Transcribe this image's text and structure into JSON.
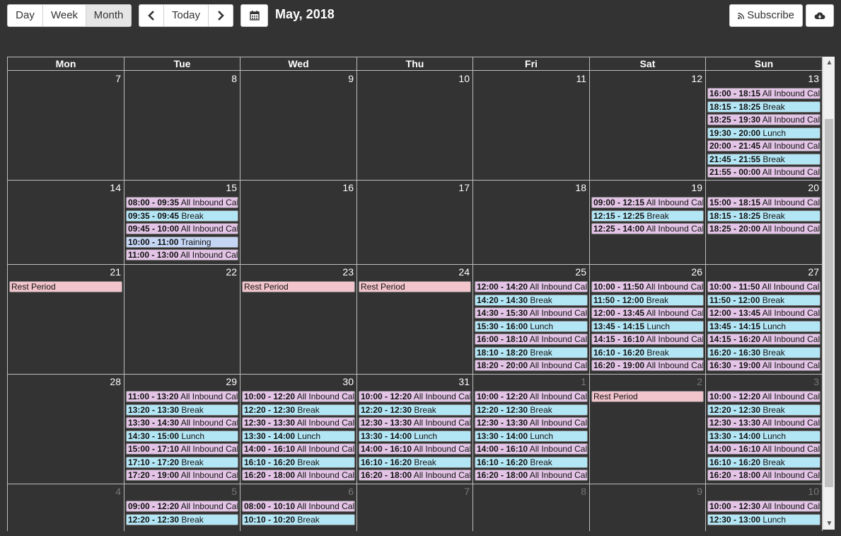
{
  "toolbar": {
    "views": [
      "Day",
      "Week",
      "Month"
    ],
    "active_view": "Month",
    "prev_icon": "chevron-left-icon",
    "today_label": "Today",
    "next_icon": "chevron-right-icon",
    "calendar_icon": "calendar-icon",
    "title": "May, 2018",
    "subscribe_label": "Subscribe",
    "subscribe_icon": "rss-icon",
    "download_icon": "cloud-download-icon"
  },
  "calendar": {
    "weekdays": [
      "Mon",
      "Tue",
      "Wed",
      "Thu",
      "Fri",
      "Sat",
      "Sun"
    ],
    "weeks": [
      [
        {
          "num": "7",
          "events": []
        },
        {
          "num": "8",
          "events": []
        },
        {
          "num": "9",
          "events": []
        },
        {
          "num": "10",
          "events": []
        },
        {
          "num": "11",
          "events": []
        },
        {
          "num": "12",
          "events": []
        },
        {
          "num": "13",
          "events": [
            {
              "time": "16:00 - 18:15",
              "label": "All Inbound Calls",
              "type": "inbound"
            },
            {
              "time": "18:15 - 18:25",
              "label": "Break",
              "type": "break"
            },
            {
              "time": "18:25 - 19:30",
              "label": "All Inbound Calls",
              "type": "inbound"
            },
            {
              "time": "19:30 - 20:00",
              "label": "Lunch",
              "type": "lunch"
            },
            {
              "time": "20:00 - 21:45",
              "label": "All Inbound Calls",
              "type": "inbound"
            },
            {
              "time": "21:45 - 21:55",
              "label": "Break",
              "type": "break"
            },
            {
              "time": "21:55 - 00:00",
              "label": "All Inbound Calls",
              "type": "inbound"
            }
          ]
        }
      ],
      [
        {
          "num": "14",
          "events": []
        },
        {
          "num": "15",
          "events": [
            {
              "time": "08:00 - 09:35",
              "label": "All Inbound Calls",
              "type": "inbound"
            },
            {
              "time": "09:35 - 09:45",
              "label": "Break",
              "type": "break"
            },
            {
              "time": "09:45 - 10:00",
              "label": "All Inbound Calls",
              "type": "inbound"
            },
            {
              "time": "10:00 - 11:00",
              "label": "Training",
              "type": "training"
            },
            {
              "time": "11:00 - 13:00",
              "label": "All Inbound Calls",
              "type": "inbound"
            }
          ]
        },
        {
          "num": "16",
          "events": []
        },
        {
          "num": "17",
          "events": []
        },
        {
          "num": "18",
          "events": []
        },
        {
          "num": "19",
          "events": [
            {
              "time": "09:00 - 12:15",
              "label": "All Inbound Calls",
              "type": "inbound"
            },
            {
              "time": "12:15 - 12:25",
              "label": "Break",
              "type": "break"
            },
            {
              "time": "12:25 - 14:00",
              "label": "All Inbound Calls",
              "type": "inbound"
            }
          ]
        },
        {
          "num": "20",
          "events": [
            {
              "time": "15:00 - 18:15",
              "label": "All Inbound Calls",
              "type": "inbound"
            },
            {
              "time": "18:15 - 18:25",
              "label": "Break",
              "type": "break"
            },
            {
              "time": "18:25 - 20:00",
              "label": "All Inbound Calls",
              "type": "inbound"
            }
          ]
        }
      ],
      [
        {
          "num": "21",
          "events": [
            {
              "time": "",
              "label": "Rest Period",
              "type": "rest"
            }
          ]
        },
        {
          "num": "22",
          "events": []
        },
        {
          "num": "23",
          "events": [
            {
              "time": "",
              "label": "Rest Period",
              "type": "rest"
            }
          ]
        },
        {
          "num": "24",
          "events": [
            {
              "time": "",
              "label": "Rest Period",
              "type": "rest"
            }
          ]
        },
        {
          "num": "25",
          "events": [
            {
              "time": "12:00 - 14:20",
              "label": "All Inbound Calls",
              "type": "inbound"
            },
            {
              "time": "14:20 - 14:30",
              "label": "Break",
              "type": "break"
            },
            {
              "time": "14:30 - 15:30",
              "label": "All Inbound Calls",
              "type": "inbound"
            },
            {
              "time": "15:30 - 16:00",
              "label": "Lunch",
              "type": "lunch"
            },
            {
              "time": "16:00 - 18:10",
              "label": "All Inbound Calls",
              "type": "inbound"
            },
            {
              "time": "18:10 - 18:20",
              "label": "Break",
              "type": "break"
            },
            {
              "time": "18:20 - 20:00",
              "label": "All Inbound Calls",
              "type": "inbound"
            }
          ]
        },
        {
          "num": "26",
          "events": [
            {
              "time": "10:00 - 11:50",
              "label": "All Inbound Calls",
              "type": "inbound"
            },
            {
              "time": "11:50 - 12:00",
              "label": "Break",
              "type": "break"
            },
            {
              "time": "12:00 - 13:45",
              "label": "All Inbound Calls",
              "type": "inbound"
            },
            {
              "time": "13:45 - 14:15",
              "label": "Lunch",
              "type": "lunch"
            },
            {
              "time": "14:15 - 16:10",
              "label": "All Inbound Calls",
              "type": "inbound"
            },
            {
              "time": "16:10 - 16:20",
              "label": "Break",
              "type": "break"
            },
            {
              "time": "16:20 - 19:00",
              "label": "All Inbound Calls",
              "type": "inbound"
            }
          ]
        },
        {
          "num": "27",
          "events": [
            {
              "time": "10:00 - 11:50",
              "label": "All Inbound Calls",
              "type": "inbound"
            },
            {
              "time": "11:50 - 12:00",
              "label": "Break",
              "type": "break"
            },
            {
              "time": "12:00 - 13:45",
              "label": "All Inbound Calls",
              "type": "inbound"
            },
            {
              "time": "13:45 - 14:15",
              "label": "Lunch",
              "type": "lunch"
            },
            {
              "time": "14:15 - 16:20",
              "label": "All Inbound Calls",
              "type": "inbound"
            },
            {
              "time": "16:20 - 16:30",
              "label": "Break",
              "type": "break"
            },
            {
              "time": "16:30 - 19:00",
              "label": "All Inbound Calls",
              "type": "inbound"
            }
          ]
        }
      ],
      [
        {
          "num": "28",
          "events": []
        },
        {
          "num": "29",
          "events": [
            {
              "time": "11:00 - 13:20",
              "label": "All Inbound Calls",
              "type": "inbound"
            },
            {
              "time": "13:20 - 13:30",
              "label": "Break",
              "type": "break"
            },
            {
              "time": "13:30 - 14:30",
              "label": "All Inbound Calls",
              "type": "inbound"
            },
            {
              "time": "14:30 - 15:00",
              "label": "Lunch",
              "type": "lunch"
            },
            {
              "time": "15:00 - 17:10",
              "label": "All Inbound Calls",
              "type": "inbound"
            },
            {
              "time": "17:10 - 17:20",
              "label": "Break",
              "type": "break"
            },
            {
              "time": "17:20 - 19:00",
              "label": "All Inbound Calls",
              "type": "inbound"
            }
          ]
        },
        {
          "num": "30",
          "events": [
            {
              "time": "10:00 - 12:20",
              "label": "All Inbound Calls",
              "type": "inbound"
            },
            {
              "time": "12:20 - 12:30",
              "label": "Break",
              "type": "break"
            },
            {
              "time": "12:30 - 13:30",
              "label": "All Inbound Calls",
              "type": "inbound"
            },
            {
              "time": "13:30 - 14:00",
              "label": "Lunch",
              "type": "lunch"
            },
            {
              "time": "14:00 - 16:10",
              "label": "All Inbound Calls",
              "type": "inbound"
            },
            {
              "time": "16:10 - 16:20",
              "label": "Break",
              "type": "break"
            },
            {
              "time": "16:20 - 18:00",
              "label": "All Inbound Calls",
              "type": "inbound"
            }
          ]
        },
        {
          "num": "31",
          "events": [
            {
              "time": "10:00 - 12:20",
              "label": "All Inbound Calls",
              "type": "inbound"
            },
            {
              "time": "12:20 - 12:30",
              "label": "Break",
              "type": "break"
            },
            {
              "time": "12:30 - 13:30",
              "label": "All Inbound Calls",
              "type": "inbound"
            },
            {
              "time": "13:30 - 14:00",
              "label": "Lunch",
              "type": "lunch"
            },
            {
              "time": "14:00 - 16:10",
              "label": "All Inbound Calls",
              "type": "inbound"
            },
            {
              "time": "16:10 - 16:20",
              "label": "Break",
              "type": "break"
            },
            {
              "time": "16:20 - 18:00",
              "label": "All Inbound Calls",
              "type": "inbound"
            }
          ]
        },
        {
          "num": "1",
          "other": true,
          "events": [
            {
              "time": "10:00 - 12:20",
              "label": "All Inbound Calls",
              "type": "inbound"
            },
            {
              "time": "12:20 - 12:30",
              "label": "Break",
              "type": "break"
            },
            {
              "time": "12:30 - 13:30",
              "label": "All Inbound Calls",
              "type": "inbound"
            },
            {
              "time": "13:30 - 14:00",
              "label": "Lunch",
              "type": "lunch"
            },
            {
              "time": "14:00 - 16:10",
              "label": "All Inbound Calls",
              "type": "inbound"
            },
            {
              "time": "16:10 - 16:20",
              "label": "Break",
              "type": "break"
            },
            {
              "time": "16:20 - 18:00",
              "label": "All Inbound Calls",
              "type": "inbound"
            }
          ]
        },
        {
          "num": "2",
          "other": true,
          "events": [
            {
              "time": "",
              "label": "Rest Period",
              "type": "rest"
            }
          ]
        },
        {
          "num": "3",
          "other": true,
          "events": [
            {
              "time": "10:00 - 12:20",
              "label": "All Inbound Calls",
              "type": "inbound"
            },
            {
              "time": "12:20 - 12:30",
              "label": "Break",
              "type": "break"
            },
            {
              "time": "12:30 - 13:30",
              "label": "All Inbound Calls",
              "type": "inbound"
            },
            {
              "time": "13:30 - 14:00",
              "label": "Lunch",
              "type": "lunch"
            },
            {
              "time": "14:00 - 16:10",
              "label": "All Inbound Calls",
              "type": "inbound"
            },
            {
              "time": "16:10 - 16:20",
              "label": "Break",
              "type": "break"
            },
            {
              "time": "16:20 - 18:00",
              "label": "All Inbound Calls",
              "type": "inbound"
            }
          ]
        }
      ],
      [
        {
          "num": "4",
          "other": true,
          "events": []
        },
        {
          "num": "5",
          "other": true,
          "events": [
            {
              "time": "09:00 - 12:20",
              "label": "All Inbound Calls",
              "type": "inbound"
            },
            {
              "time": "12:20 - 12:30",
              "label": "Break",
              "type": "break"
            }
          ]
        },
        {
          "num": "6",
          "other": true,
          "events": [
            {
              "time": "08:00 - 10:10",
              "label": "All Inbound Calls",
              "type": "inbound"
            },
            {
              "time": "10:10 - 10:20",
              "label": "Break",
              "type": "break"
            }
          ]
        },
        {
          "num": "7",
          "other": true,
          "events": []
        },
        {
          "num": "8",
          "other": true,
          "events": []
        },
        {
          "num": "9",
          "other": true,
          "events": []
        },
        {
          "num": "10",
          "other": true,
          "events": [
            {
              "time": "10:00 - 12:30",
              "label": "All Inbound Calls",
              "type": "inbound"
            },
            {
              "time": "12:30 - 13:00",
              "label": "Lunch",
              "type": "lunch"
            }
          ]
        }
      ]
    ]
  }
}
